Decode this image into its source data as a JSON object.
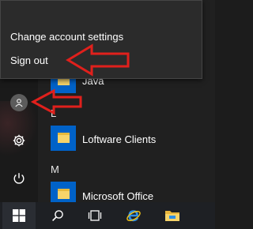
{
  "account_menu": {
    "items": [
      {
        "label": "Change account settings"
      },
      {
        "label": "Sign out"
      }
    ]
  },
  "app_list": {
    "rows": [
      {
        "label": "Java",
        "type": "folder"
      },
      {
        "label": "Loftware Clients",
        "type": "folder"
      },
      {
        "label": "Microsoft Office",
        "type": "folder"
      }
    ],
    "section_letters": [
      "L",
      "M"
    ]
  },
  "left_rail": {
    "icons": [
      "user-account-icon",
      "settings-gear-icon",
      "power-icon"
    ]
  },
  "taskbar": {
    "icons": [
      "windows-start-icon",
      "search-icon",
      "task-view-icon",
      "internet-explorer-icon",
      "file-explorer-icon"
    ]
  },
  "colors": {
    "annotation_arrow": "#e0201c",
    "tile_blue": "#0062c8",
    "menu_background": "#2b2b2b"
  }
}
